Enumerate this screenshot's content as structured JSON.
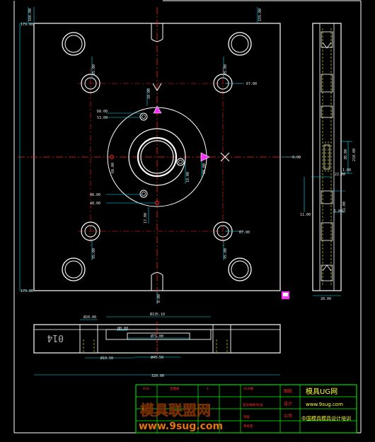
{
  "colors": {
    "background": "#000000",
    "outline": "#ffffff",
    "centerline": "#ff2020",
    "dimension": "#00e5ff",
    "hidden_line": "#ffff00",
    "title_block_border": "#00ff00",
    "title_text_red": "#ff3030",
    "title_text_yellow": "#ffff30",
    "accent_magenta": "#ff30ff",
    "watermark_orange": "#ff8a1a"
  },
  "plan_view": {
    "dim_left_top": "179.00",
    "dim_left_bottom": "179.00",
    "dim_top_a": "166.00",
    "dim_top_b": "155.00",
    "dim_hole_ur_a": "95.00",
    "dim_hole_ur_b": "67.00",
    "dim_hole_lr_a": "67.00",
    "dim_hole_lr_b": "95.00",
    "dim_hole_ul": "95.00",
    "dim_hole_ll": "95.00",
    "dim_vert_upper": "10.00",
    "dim_left_small_a": "D8.00",
    "dim_left_small_b": "53.00",
    "dim_left_small_c": "48.00",
    "dim_left_small_d": "48.00",
    "dim_center_left": "60.00",
    "dim_center_right": "20.00",
    "dim_center_small": "18.00",
    "dim_right_edge": "0.00",
    "dim_bottom": "0.00",
    "dim_lower_small": "17.00"
  },
  "side_view": {
    "dim_a": "210.00",
    "dim_b": "30.00",
    "dim_c": "22.00",
    "dim_d": "1.00",
    "dim_e": "51.00",
    "dim_f": "1.00",
    "dim_g": "11.00",
    "dim_bottom": "28.00"
  },
  "section_view": {
    "label_014": "014",
    "dim_a": "Ø20.00",
    "dim_b": "Ø135.10",
    "dim_c": "Ø8.00",
    "dim_d": "Ø71.00",
    "dim_e": "Ø10.50",
    "dim_f": "Ø45.50",
    "dim_bottom": "320.00"
  },
  "title_block": {
    "part_no": "014",
    "part_name_label": "定模板",
    "qty": "1",
    "material": "45#钢",
    "row2_a": "型号规格/标准",
    "drawing_label": "图纸",
    "designer_label": "设计",
    "brand_cn": "模具UG网",
    "url": "www.9sug.com",
    "company": "中国模具模具设计培训",
    "row_checker": "审核",
    "row_company_label": "公司",
    "row_approve": "审核者"
  },
  "watermark": {
    "text_cn": "模具联盟网",
    "url": "www.9sug.com"
  }
}
